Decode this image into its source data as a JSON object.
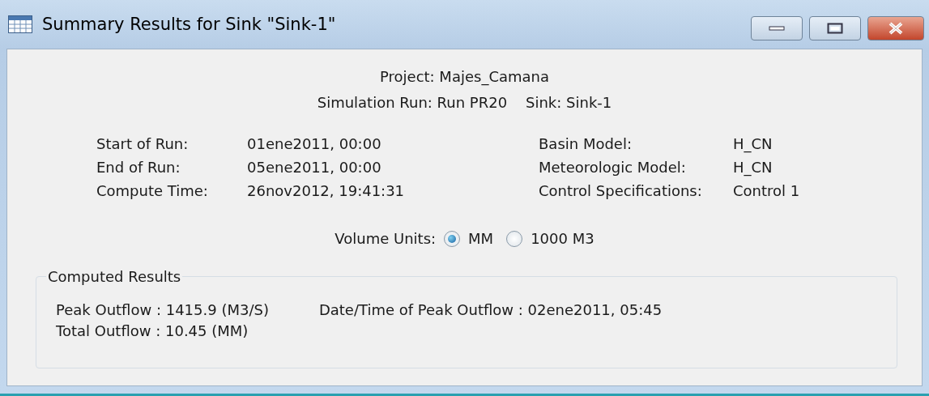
{
  "window": {
    "title": "Summary Results for Sink \"Sink-1\""
  },
  "header": {
    "project": "Project: Majes_Camana",
    "run": "Simulation Run: Run PR20",
    "sink": "Sink: Sink-1"
  },
  "info_left": [
    {
      "label": "Start of Run:",
      "value": "01ene2011, 00:00"
    },
    {
      "label": "End of Run:",
      "value": "05ene2011, 00:00"
    },
    {
      "label": "Compute Time:",
      "value": "26nov2012, 19:41:31"
    }
  ],
  "info_right": [
    {
      "label": "Basin Model:",
      "value": "H_CN"
    },
    {
      "label": "Meteorologic Model:",
      "value": "H_CN"
    },
    {
      "label": "Control Specifications:",
      "value": "Control 1"
    }
  ],
  "volume_units": {
    "label": "Volume Units:",
    "options": [
      {
        "label": "MM",
        "selected": true
      },
      {
        "label": "1000 M3",
        "selected": false
      }
    ]
  },
  "computed_results": {
    "title": "Computed Results",
    "left": [
      "Peak Outflow : 1415.9 (M3/S)",
      "Total Outflow : 10.45 (MM)"
    ],
    "right": [
      "Date/Time of Peak Outflow : 02ene2011, 05:45"
    ]
  }
}
